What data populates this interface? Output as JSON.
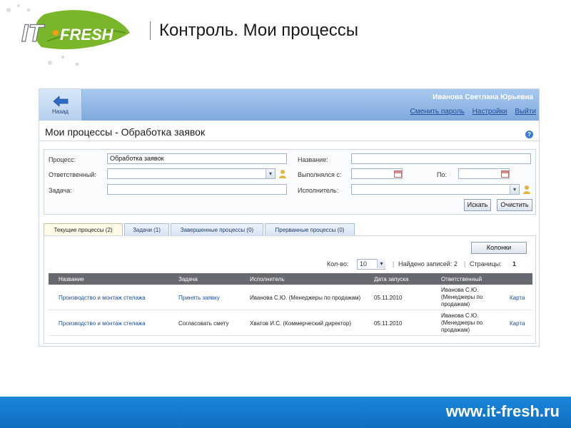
{
  "slide": {
    "logo_text_it": "IT",
    "logo_text_fresh": "FRESH",
    "title": "Контроль. Мои процессы",
    "footer_url": "www.it-fresh.ru"
  },
  "app": {
    "back_label": "Назад",
    "user_name": "Иванова Светлана Юрьевна",
    "links": [
      "Сменить пароль",
      "Настройки",
      "Выйти"
    ],
    "page_title": "Мои процессы - Обработка заявок",
    "help_icon": "?"
  },
  "filter": {
    "process_label": "Процесс:",
    "process_value": "Обработка заявок",
    "responsible_label": "Ответственный:",
    "responsible_value": "",
    "task_label": "Задача:",
    "task_value": "",
    "name_label": "Название:",
    "name_value": "",
    "done_from_label": "Выполнялся с:",
    "done_from_value": "",
    "to_label": "По:",
    "to_value": "",
    "executor_label": "Исполнитель:",
    "executor_value": "",
    "search_button": "Искать",
    "clear_button": "Очистить"
  },
  "tabs": [
    {
      "label": "Текущие процессы (2)",
      "active": true
    },
    {
      "label": "Задачи (1)",
      "active": false
    },
    {
      "label": "Завершенные процессы (0)",
      "active": false
    },
    {
      "label": "Прерванные процессы (0)",
      "active": false
    }
  ],
  "grid_controls": {
    "columns_button": "Колонки",
    "count_label": "Кол-во:",
    "count_value": "10",
    "found_label": "Найдено записей: 2",
    "pages_label": "Страницы:",
    "current_page": "1"
  },
  "table": {
    "headers": [
      "Название",
      "Задача",
      "Исполнитель",
      "Дата запуска",
      "Ответственный"
    ],
    "rows": [
      {
        "name": "Производство и монтаж стелажа",
        "task": "Принять заявку",
        "executor": "Иванова С.Ю. (Менеджеры по продажам)",
        "date": "05.11.2010",
        "responsible_1": "Иванова С.Ю.",
        "responsible_2": "(Менеджеры по",
        "responsible_3": "продажам)",
        "map": "Карта"
      },
      {
        "name": "Производство и монтаж стелажа",
        "task": "Согласовать смету",
        "executor": "Хватов И.С. (Коммерческий директор)",
        "date": "05.11.2010",
        "responsible_1": "Иванова С.Ю.",
        "responsible_2": "(Менеджеры по",
        "responsible_3": "продажам)",
        "map": "Карта"
      }
    ]
  },
  "colors": {
    "topbar": "#8fb5e6",
    "link": "#1c4d98",
    "grid_header": "#666a70",
    "footer": "#1580d2",
    "logo_leaf": "#7ab62a"
  }
}
